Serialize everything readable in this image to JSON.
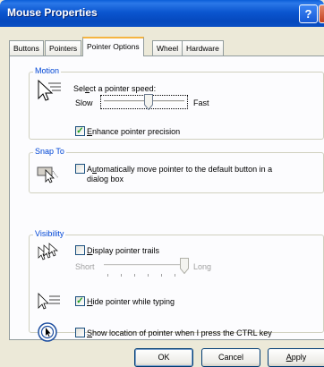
{
  "window": {
    "title": "Mouse Properties",
    "help_glyph": "?",
    "close_glyph": "X"
  },
  "tabs": [
    {
      "label": "Buttons"
    },
    {
      "label": "Pointers"
    },
    {
      "label": "Pointer Options",
      "active": true
    },
    {
      "label": "Wheel"
    },
    {
      "label": "Hardware"
    }
  ],
  "motion": {
    "title": "Motion",
    "speed_label_pre": "Sel",
    "speed_label_u": "e",
    "speed_label_post": "ct a pointer speed:",
    "slow": "Slow",
    "fast": "Fast",
    "speed_level": 0.55,
    "precision_u": "E",
    "precision_rest": "nhance pointer precision",
    "precision_checked": true
  },
  "snap": {
    "title": "Snap To",
    "pre": "A",
    "u": "u",
    "line1_rest": "tomatically move pointer to the default button in a",
    "line2": "dialog box",
    "checked": false
  },
  "visibility": {
    "title": "Visibility",
    "trails_u": "D",
    "trails_rest": "isplay pointer trails",
    "trails_checked": false,
    "short": "Short",
    "long": "Long",
    "trail_level": 1.0,
    "hide_u": "H",
    "hide_rest": "ide pointer while typing",
    "hide_checked": true,
    "ctrl_u": "S",
    "ctrl_rest": "how location of pointer when I press the CTRL key",
    "ctrl_checked": false
  },
  "buttons": {
    "ok": "OK",
    "cancel": "Cancel",
    "apply_u": "A",
    "apply_rest": "pply"
  },
  "colors": {
    "title_bar": "#0548bd",
    "group_title": "#0046d5",
    "check": "#21a121",
    "active_tab_accent": "#f5b441"
  }
}
